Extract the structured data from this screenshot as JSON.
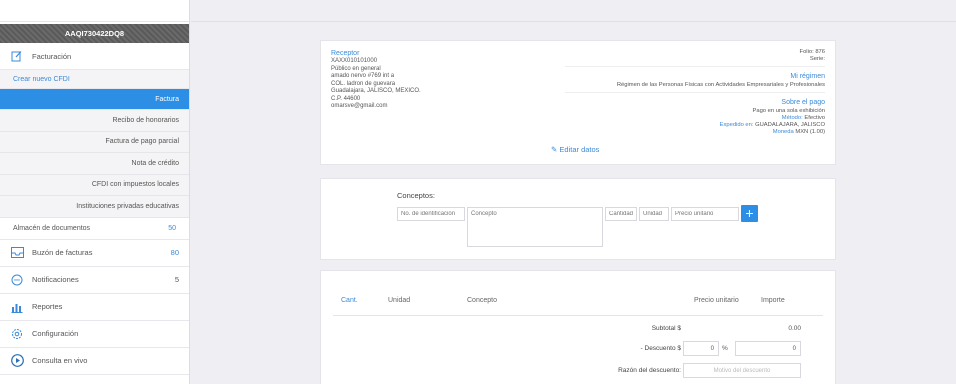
{
  "sidebar": {
    "rfc": "AAQI730422DQ8",
    "facturacion_label": "Facturación",
    "crear_label": "Crear nuevo CFDI",
    "sub_items": [
      "Factura",
      "Recibo de honorarios",
      "Factura de pago parcial",
      "Nota de crédito",
      "CFDI con impuestos locales",
      "Instituciones privadas educativas"
    ],
    "almacen_label": "Almacén de documentos",
    "almacen_count": "50",
    "buzon_label": "Buzón de facturas",
    "buzon_count": "80",
    "notificaciones_label": "Notificaciones",
    "notificaciones_count": "5",
    "reportes_label": "Reportes",
    "configuracion_label": "Configuración",
    "consulta_label": "Consulta en vivo"
  },
  "receptor": {
    "title": "Receptor",
    "rfc": "XAXX010101000",
    "name": "Público en general",
    "street": "amado nervo #769 int a",
    "colonia": "COL. ladron de guevara",
    "city": "Guadalajara, JALISCO, MEXICO.",
    "cp": "C.P. 44600",
    "email": "omarsve@gmail.com"
  },
  "emisor": {
    "folio": "Folio: 876",
    "serie": "Serie:",
    "regimen_title": "Mi régimen",
    "regimen": "Régimen de las Personas Físicas con Actividades Empresariales y Profesionales",
    "pago_title": "Sobre el pago",
    "pago_forma": "Pago en una sola exhibición",
    "metodo_label": "Método:",
    "metodo_value": "Efectivo",
    "expedido_label": "Expedido en:",
    "expedido_value": "GUADALAJARA, JALISCO",
    "moneda_label": "Moneda",
    "moneda_value": "MXN (1.00)"
  },
  "edit_label": "Editar datos",
  "conceptos": {
    "label": "Conceptos:",
    "id_placeholder": "No. de identificación",
    "concepto_placeholder": "Concepto",
    "cantidad_placeholder": "Cantidad",
    "unidad_placeholder": "Unidad",
    "precio_placeholder": "Precio unitario",
    "add_label": "+"
  },
  "tabla": {
    "cant": "Cant.",
    "unidad": "Unidad",
    "concepto": "Concepto",
    "precio": "Precio unitario",
    "importe": "Importe",
    "subtotal_label": "Subtotal $",
    "subtotal_value": "0.00",
    "descuento_label": "- Descuento $",
    "descuento_pct": "0",
    "pct_sign": "%",
    "descuento_value": "0",
    "razon_label": "Razón del descuento:",
    "razon_placeholder": "Motivo del descuento"
  }
}
